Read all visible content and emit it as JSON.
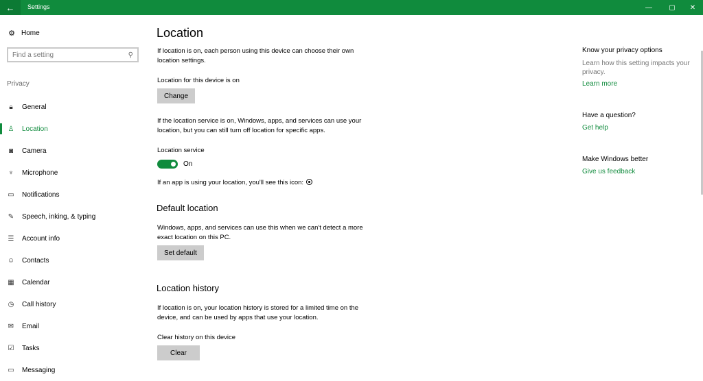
{
  "window": {
    "title": "Settings",
    "back_glyph": "←",
    "minimize_glyph": "—",
    "maximize_glyph": "▢",
    "close_glyph": "✕"
  },
  "sidebar": {
    "home_label": "Home",
    "search_placeholder": "Find a setting",
    "section_label": "Privacy",
    "items": [
      {
        "label": "General",
        "icon": "lock-icon",
        "glyph": "🔒︎"
      },
      {
        "label": "Location",
        "icon": "location-person-icon",
        "glyph": "♙"
      },
      {
        "label": "Camera",
        "icon": "camera-icon",
        "glyph": "◙"
      },
      {
        "label": "Microphone",
        "icon": "microphone-icon",
        "glyph": "♆"
      },
      {
        "label": "Notifications",
        "icon": "notifications-icon",
        "glyph": "▭"
      },
      {
        "label": "Speech, inking, & typing",
        "icon": "speech-inking-icon",
        "glyph": "✎"
      },
      {
        "label": "Account info",
        "icon": "account-info-icon",
        "glyph": "☰"
      },
      {
        "label": "Contacts",
        "icon": "contacts-icon",
        "glyph": "☺"
      },
      {
        "label": "Calendar",
        "icon": "calendar-icon",
        "glyph": "▦"
      },
      {
        "label": "Call history",
        "icon": "call-history-icon",
        "glyph": "◷"
      },
      {
        "label": "Email",
        "icon": "email-icon",
        "glyph": "✉"
      },
      {
        "label": "Tasks",
        "icon": "tasks-icon",
        "glyph": "☑"
      },
      {
        "label": "Messaging",
        "icon": "messaging-icon",
        "glyph": "▭"
      }
    ]
  },
  "main": {
    "title": "Location",
    "intro": "If location is on, each person using this device can choose their own location settings.",
    "device_status": "Location for this device is on",
    "change_button": "Change",
    "service_desc": "If the location service is on, Windows, apps, and services can use your location, but you can still turn off location for specific apps.",
    "service_label": "Location service",
    "service_toggle": "On",
    "icon_note": "If an app is using your location, you'll see this icon:",
    "default_heading": "Default location",
    "default_desc": "Windows, apps, and services can use this when we can't detect a more exact location on this PC.",
    "set_default_button": "Set default",
    "history_heading": "Location history",
    "history_desc": "If location is on, your location history is stored for a limited time on the device, and can be used by apps that use your location.",
    "clear_label": "Clear history on this device",
    "clear_button": "Clear"
  },
  "right_panel": {
    "privacy_heading": "Know your privacy options",
    "privacy_text": "Learn how this setting impacts your privacy.",
    "learn_more": "Learn more",
    "question_heading": "Have a question?",
    "get_help": "Get help",
    "better_heading": "Make Windows better",
    "feedback": "Give us feedback"
  },
  "colors": {
    "accent": "#108b3d",
    "button_bg": "#cccccc"
  }
}
